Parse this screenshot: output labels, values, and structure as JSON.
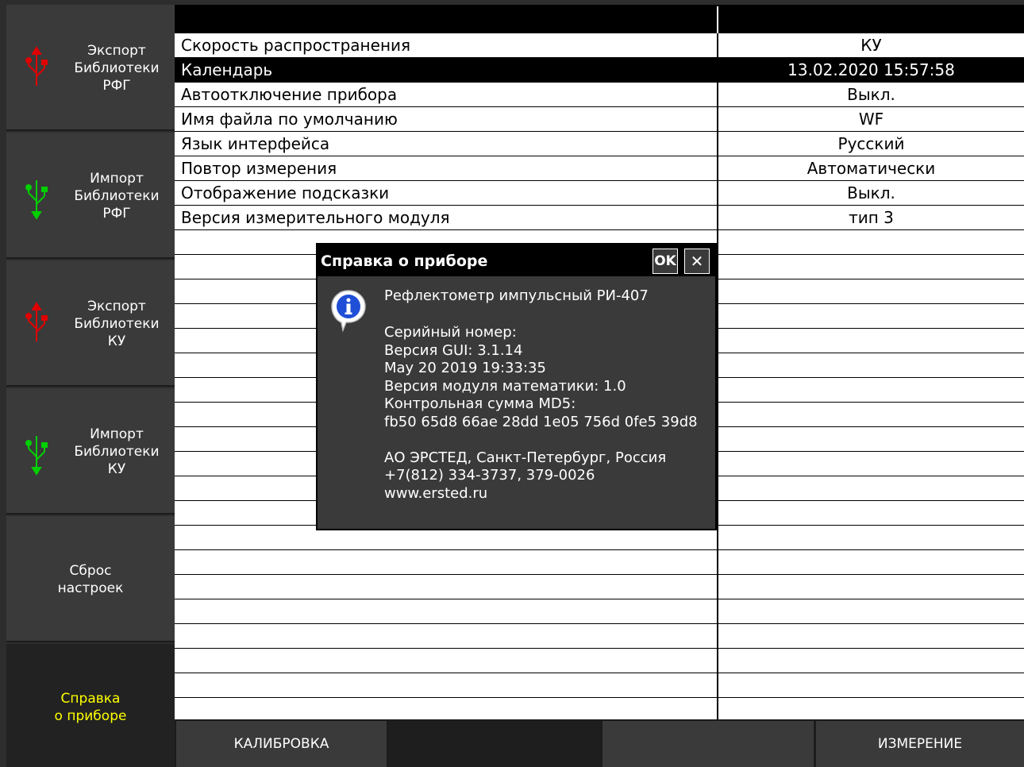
{
  "sidebar": {
    "items": [
      {
        "label_lines": [
          "Экспорт",
          "Библиотеки",
          "РФГ"
        ],
        "icon": "usb-export-icon",
        "icon_color": "#e00000"
      },
      {
        "label_lines": [
          "Импорт",
          "Библиотеки",
          "РФГ"
        ],
        "icon": "usb-import-icon",
        "icon_color": "#00d000"
      },
      {
        "label_lines": [
          "Экспорт",
          "Библиотеки",
          "КУ"
        ],
        "icon": "usb-export-icon",
        "icon_color": "#e00000"
      },
      {
        "label_lines": [
          "Импорт",
          "Библиотеки",
          "КУ"
        ],
        "icon": "usb-import-icon",
        "icon_color": "#00d000"
      },
      {
        "label_lines": [
          "Сброс",
          "настроек"
        ]
      },
      {
        "label_lines": [
          "Справка",
          "о приборе"
        ],
        "active": true
      }
    ]
  },
  "settings": {
    "rows": [
      {
        "name": "Скорость распространения",
        "value": "КУ"
      },
      {
        "name": "Календарь",
        "value": "13.02.2020  15:57:58",
        "selected": true
      },
      {
        "name": "Автоотключение прибора",
        "value": "Выкл."
      },
      {
        "name": "Имя файла по умолчанию",
        "value": "WF"
      },
      {
        "name": "Язык интерфейса",
        "value": "Русский"
      },
      {
        "name": "Повтор измерения",
        "value": "Автоматически"
      },
      {
        "name": "Отображение подсказки",
        "value": "Выкл."
      },
      {
        "name": "Версия измерительного модуля",
        "value": "тип 3"
      }
    ]
  },
  "bottombar": {
    "buttons": [
      "КАЛИБРОВКА",
      "",
      "",
      "ИЗМЕРЕНИЕ"
    ]
  },
  "dialog": {
    "title": "Справка о приборе",
    "ok_label": "OK",
    "close_label": "✕",
    "device": "Рефлектометр импульсный РИ-407",
    "serial": "Серийный номер:",
    "gui_version": "Версия GUI: 3.1.14",
    "build_date": "May 20 2019 19:33:35",
    "math_version": "Версия модуля математики: 1.0",
    "md5_label": "Контрольная сумма MD5:",
    "md5": "fb50 65d8 66ae 28dd 1e05 756d 0fe5 39d8",
    "company": "АО ЭРСТЕД, Санкт-Петербург, Россия",
    "phone": "+7(812) 334-3737, 379-0026",
    "website": "www.ersted.ru"
  },
  "colors": {
    "active_label": "#ffff00",
    "export_icon": "#e00000",
    "import_icon": "#00d000"
  }
}
